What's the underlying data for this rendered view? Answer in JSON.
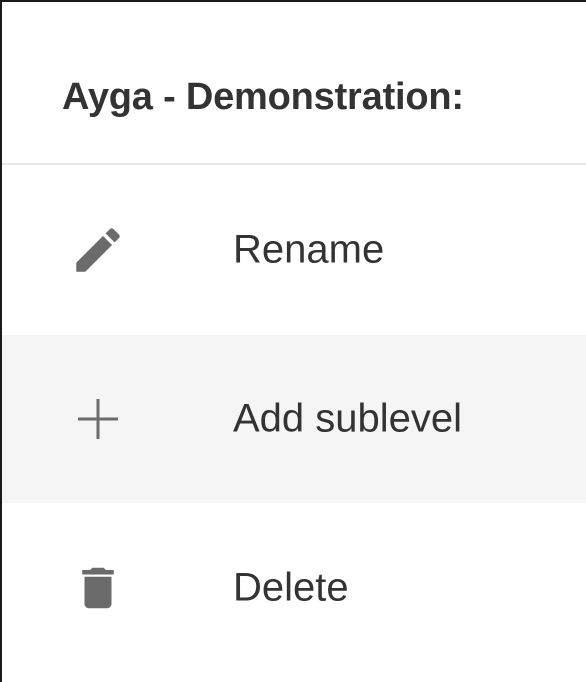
{
  "menu": {
    "title": "Ayga - Demonstration:",
    "items": [
      {
        "label": "Rename",
        "icon": "pencil-icon"
      },
      {
        "label": "Add sublevel",
        "icon": "plus-icon"
      },
      {
        "label": "Delete",
        "icon": "trash-icon"
      }
    ]
  },
  "colors": {
    "text": "#333333",
    "icon": "#6b6b6b",
    "hover_background": "#f5f5f5",
    "divider": "#e6e6e6"
  }
}
